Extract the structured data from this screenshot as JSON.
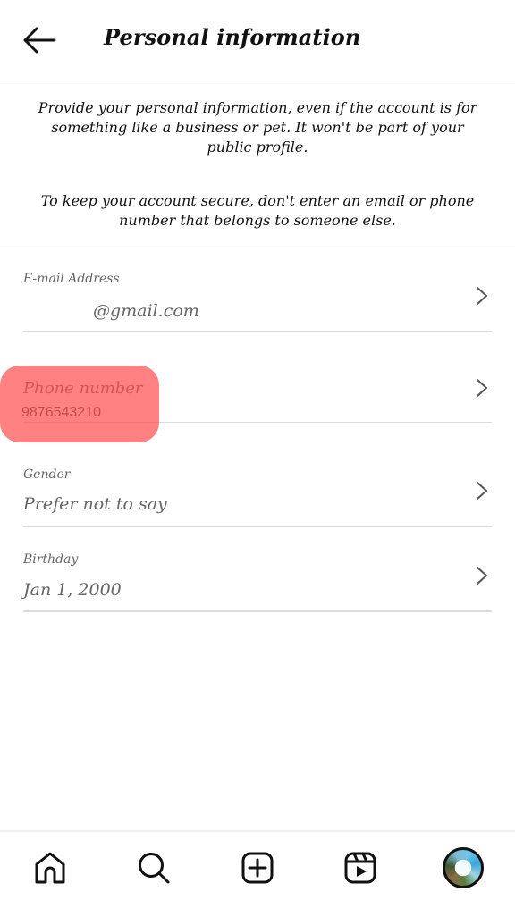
{
  "header": {
    "title": "Personal information",
    "back_icon": "arrow-left-icon"
  },
  "intro": {
    "paragraph1": "Provide your personal information, even if the account is for something like a business or pet. It won't be part of your public profile.",
    "paragraph2": "To keep your account secure, don't enter an email or phone number that belongs to someone else."
  },
  "fields": [
    {
      "label": "E-mail Address",
      "value": "@gmail.com",
      "icon": "chevron-right-icon"
    },
    {
      "label": "Phone number",
      "value": "9876543210",
      "icon": "chevron-right-icon"
    },
    {
      "label": "Gender",
      "value": "Prefer not to say",
      "icon": "chevron-right-icon"
    },
    {
      "label": "Birthday",
      "value": "Jan 1, 2000",
      "icon": "chevron-right-icon"
    }
  ],
  "highlight": {
    "target": "Phone number",
    "color": "#ff5050"
  },
  "bottom_nav": {
    "items": [
      {
        "name": "home",
        "icon": "home-icon"
      },
      {
        "name": "search",
        "icon": "search-icon"
      },
      {
        "name": "create",
        "icon": "plus-square-icon"
      },
      {
        "name": "reels",
        "icon": "reels-icon"
      },
      {
        "name": "profile",
        "icon": "avatar"
      }
    ]
  }
}
